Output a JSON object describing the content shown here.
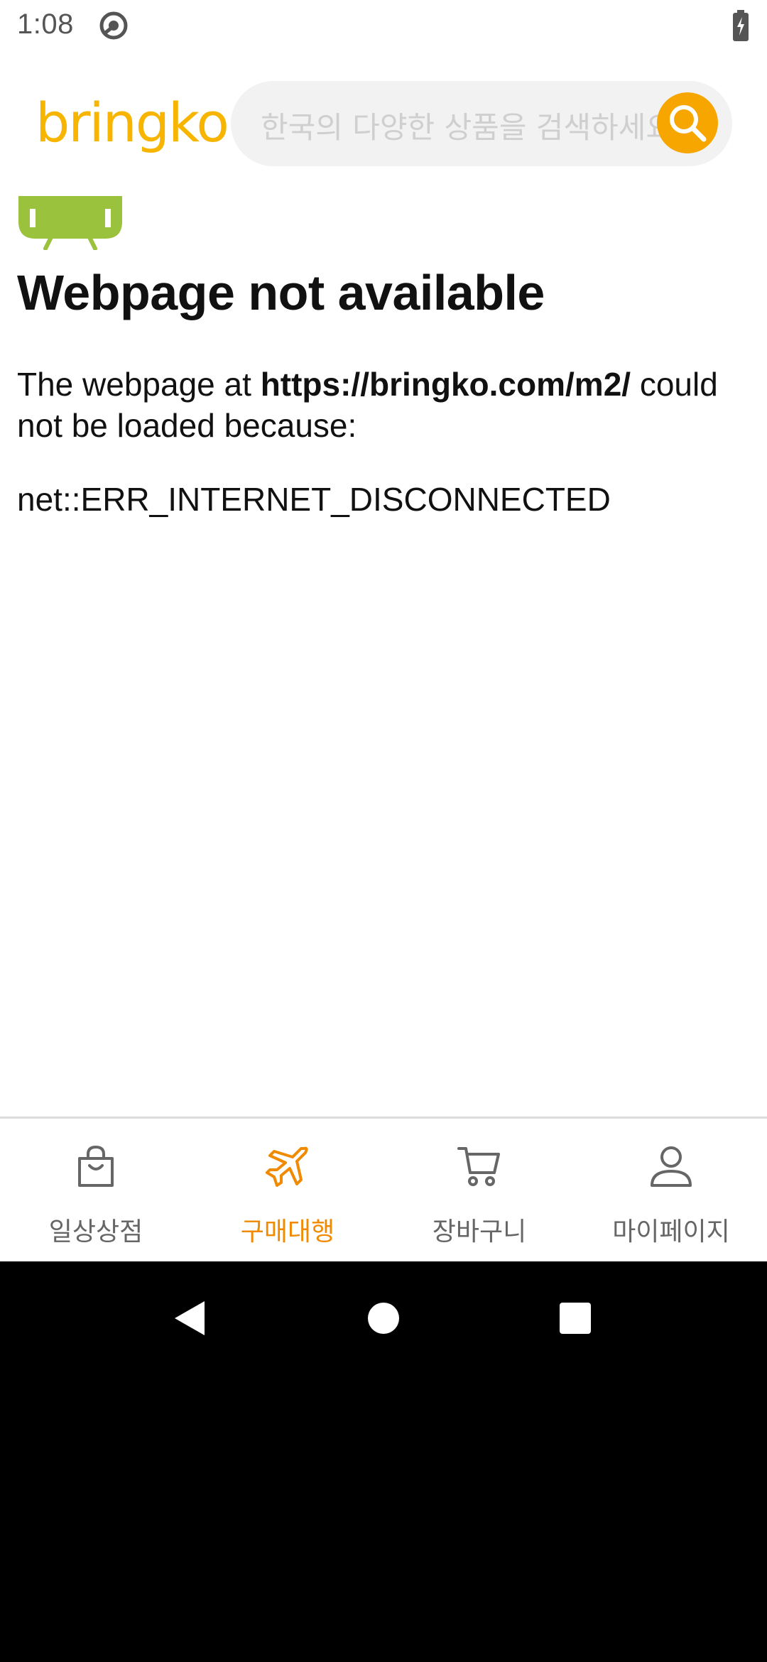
{
  "status_bar": {
    "time": "1:08",
    "sync_icon": "sync-icon",
    "battery_icon": "battery-charging-icon"
  },
  "header": {
    "logo": "bringko",
    "search_placeholder": "한국의 다양한 상품을 검색하세요",
    "search_icon": "search-icon"
  },
  "error_page": {
    "title": "Webpage not available",
    "message_prefix": "The webpage at ",
    "url": "https://bringko.com/m2/",
    "message_suffix": " could not be loaded because:",
    "error_code": "net::ERR_INTERNET_DISCONNECTED"
  },
  "bottom_nav": {
    "items": [
      {
        "label": "일상상점",
        "icon": "shopping-bag-icon",
        "active": false
      },
      {
        "label": "구매대행",
        "icon": "airplane-icon",
        "active": true
      },
      {
        "label": "장바구니",
        "icon": "cart-icon",
        "active": false
      },
      {
        "label": "마이페이지",
        "icon": "person-icon",
        "active": false
      }
    ]
  },
  "colors": {
    "brand_yellow": "#f7b500",
    "search_orange": "#f7a600",
    "active_nav": "#f08a00",
    "inactive_nav": "#666666",
    "android_green": "#9bc23c"
  }
}
